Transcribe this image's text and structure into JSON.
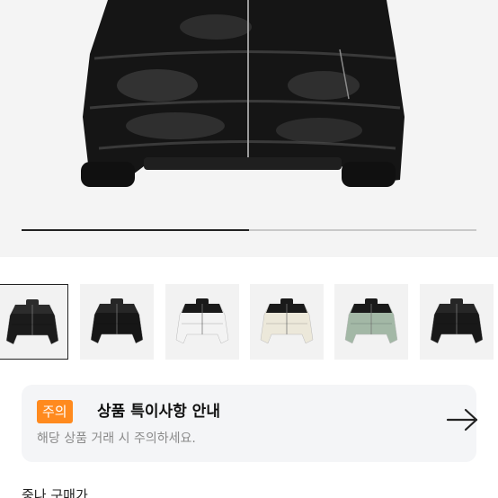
{
  "product_image": {
    "icon": "down-jacket-image",
    "slide_progress": 0.5
  },
  "thumbnails": [
    {
      "name": "thumb-black-shiny",
      "colors": [
        "#1b1b1b",
        "#2c2c2c"
      ],
      "selected": true
    },
    {
      "name": "thumb-black-matte",
      "colors": [
        "#161616",
        "#262626"
      ],
      "selected": false
    },
    {
      "name": "thumb-white-black",
      "colors": [
        "#f3f3f3",
        "#1a1a1a"
      ],
      "selected": false
    },
    {
      "name": "thumb-cream-black",
      "colors": [
        "#ece8da",
        "#1a1a1a"
      ],
      "selected": false
    },
    {
      "name": "thumb-sage-black",
      "colors": [
        "#a3b8a6",
        "#1a1a1a"
      ],
      "selected": false
    },
    {
      "name": "thumb-black-2",
      "colors": [
        "#181818",
        "#262626"
      ],
      "selected": false
    }
  ],
  "notice": {
    "badge": "주의",
    "title": "상품 특이사항 안내",
    "subtitle": "해당 상품 거래 시 주의하세요.",
    "arrow_icon": "arrow-right-icon",
    "badge_color": "#ff8a1e"
  },
  "next_section_peek": "중나 구매가"
}
